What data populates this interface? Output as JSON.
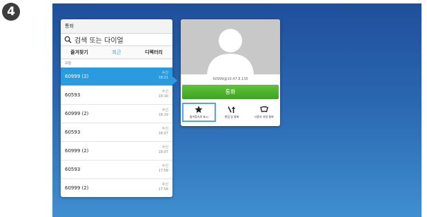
{
  "step_number": "4",
  "panel": {
    "title": "통화",
    "search_placeholder": "검색 또는 다이얼",
    "tabs": [
      "즐겨찾기",
      "최근",
      "디렉터리"
    ],
    "section_label": "오늘",
    "rows": [
      {
        "name": "60999 (2)",
        "type": "수신",
        "time": "18:21",
        "selected": true
      },
      {
        "name": "60593",
        "type": "수신",
        "time": "18:16"
      },
      {
        "name": "60999 (2)",
        "type": "수신",
        "time": "18:19"
      },
      {
        "name": "60593",
        "type": "수신",
        "time": "18:07"
      },
      {
        "name": "60999 (2)",
        "type": "수신",
        "time": "18:07"
      },
      {
        "name": "60593",
        "type": "수신",
        "time": "17:58"
      },
      {
        "name": "60999 (2)",
        "type": "수신",
        "time": "17:58"
      }
    ]
  },
  "card": {
    "address": "60999@10.47.8.135",
    "call_label": "통화",
    "actions": [
      {
        "label": "즐겨찾기로 표시",
        "icon": "star-icon"
      },
      {
        "label": "편집 및 통화",
        "icon": "edit-call-icon"
      },
      {
        "label": "사용자 지정 통화",
        "icon": "custom-call-icon"
      }
    ]
  },
  "colors": {
    "accent_blue": "#2b9be0",
    "call_green": "#4fb52f",
    "background_blue": "#2a66b1"
  }
}
